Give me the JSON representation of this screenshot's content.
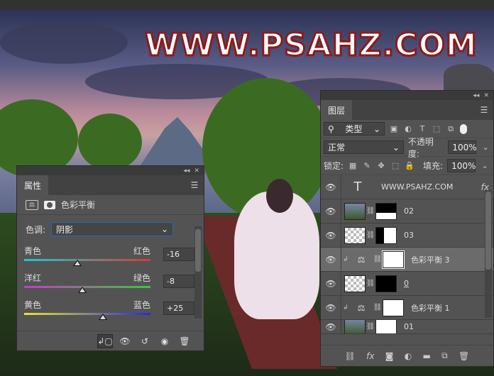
{
  "watermark": "WWW.PSAHZ.COM",
  "properties": {
    "tab": "属性",
    "adjustment_name": "色彩平衡",
    "tone_label": "色调:",
    "tone_value": "阴影",
    "sliders": [
      {
        "left": "青色",
        "right": "红色",
        "value": "-16",
        "level": -16
      },
      {
        "left": "洋红",
        "right": "绿色",
        "value": "-8",
        "level": -8
      },
      {
        "left": "黄色",
        "right": "蓝色",
        "value": "+25",
        "level": 25
      }
    ],
    "colors": {
      "accent": "#2e64b5"
    }
  },
  "layers": {
    "tab": "图层",
    "filter_kind": "类型",
    "blend_mode": "正常",
    "opacity_label": "不透明度:",
    "opacity_value": "100%",
    "lock_label": "锁定:",
    "fill_label": "填充:",
    "fill_value": "100%",
    "items": [
      {
        "name": "WWW.PSAHZ.COM",
        "kind": "text",
        "fx": "fx"
      },
      {
        "name": "02",
        "kind": "image"
      },
      {
        "name": "03",
        "kind": "image"
      },
      {
        "name": "色彩平衡 3",
        "kind": "adjustment",
        "selected": true
      },
      {
        "name": "0",
        "kind": "image"
      },
      {
        "name": "色彩平衡 1",
        "kind": "adjustment"
      },
      {
        "name": "01",
        "kind": "image"
      }
    ]
  }
}
